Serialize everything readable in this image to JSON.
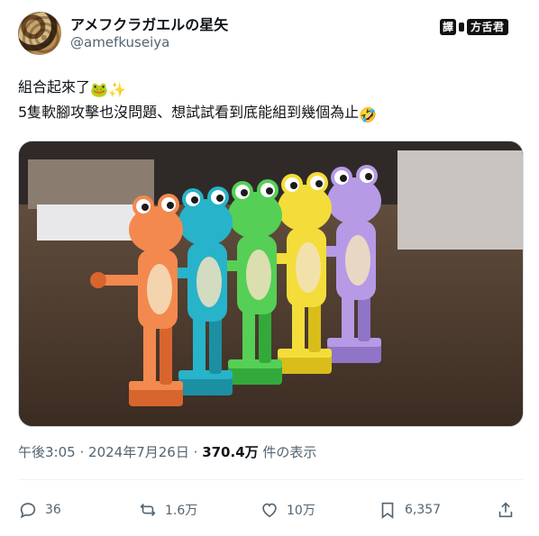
{
  "author": {
    "display_name": "アメフクラガエルの星矢",
    "handle": "@amefkuseiya"
  },
  "translation_badge": {
    "label": "譯",
    "brand": "方舌君"
  },
  "tweet": {
    "line1": "組合起來了",
    "line1_emojis": "🐸✨",
    "line2": "5隻軟腳攻擊也沒問題、想試試看到底能組到幾個為止",
    "line2_emoji": "🤣"
  },
  "media": {
    "figures": [
      {
        "color": "#f3894e",
        "shade": "#d8652e",
        "name": "orange"
      },
      {
        "color": "#27b3c9",
        "shade": "#1d8fa3",
        "name": "cyan"
      },
      {
        "color": "#56cf56",
        "shade": "#33a93b",
        "name": "green"
      },
      {
        "color": "#f4dd3a",
        "shade": "#d8bd1b",
        "name": "yellow"
      },
      {
        "color": "#b69ae6",
        "shade": "#9074c8",
        "name": "purple"
      }
    ]
  },
  "meta": {
    "time": "午後3:05",
    "date": "2024年7月26日",
    "separator": "·",
    "views": "370.4万",
    "views_label": "件の表示"
  },
  "actions": {
    "replies": "36",
    "reposts": "1.6万",
    "likes": "10万",
    "bookmarks": "6,357"
  }
}
